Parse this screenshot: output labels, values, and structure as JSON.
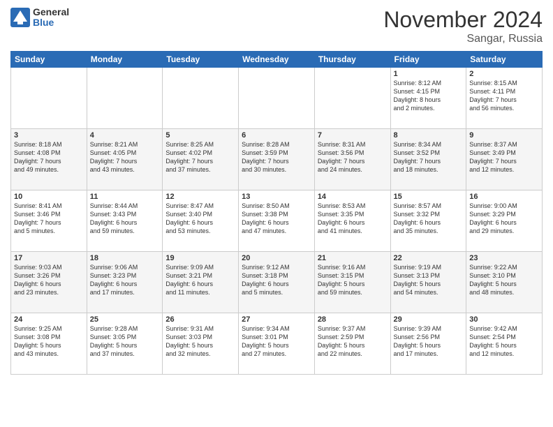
{
  "header": {
    "logo_general": "General",
    "logo_blue": "Blue",
    "month_title": "November 2024",
    "location": "Sangar, Russia"
  },
  "weekdays": [
    "Sunday",
    "Monday",
    "Tuesday",
    "Wednesday",
    "Thursday",
    "Friday",
    "Saturday"
  ],
  "weeks": [
    [
      {
        "day": "",
        "info": ""
      },
      {
        "day": "",
        "info": ""
      },
      {
        "day": "",
        "info": ""
      },
      {
        "day": "",
        "info": ""
      },
      {
        "day": "",
        "info": ""
      },
      {
        "day": "1",
        "info": "Sunrise: 8:12 AM\nSunset: 4:15 PM\nDaylight: 8 hours\nand 2 minutes."
      },
      {
        "day": "2",
        "info": "Sunrise: 8:15 AM\nSunset: 4:11 PM\nDaylight: 7 hours\nand 56 minutes."
      }
    ],
    [
      {
        "day": "3",
        "info": "Sunrise: 8:18 AM\nSunset: 4:08 PM\nDaylight: 7 hours\nand 49 minutes."
      },
      {
        "day": "4",
        "info": "Sunrise: 8:21 AM\nSunset: 4:05 PM\nDaylight: 7 hours\nand 43 minutes."
      },
      {
        "day": "5",
        "info": "Sunrise: 8:25 AM\nSunset: 4:02 PM\nDaylight: 7 hours\nand 37 minutes."
      },
      {
        "day": "6",
        "info": "Sunrise: 8:28 AM\nSunset: 3:59 PM\nDaylight: 7 hours\nand 30 minutes."
      },
      {
        "day": "7",
        "info": "Sunrise: 8:31 AM\nSunset: 3:56 PM\nDaylight: 7 hours\nand 24 minutes."
      },
      {
        "day": "8",
        "info": "Sunrise: 8:34 AM\nSunset: 3:52 PM\nDaylight: 7 hours\nand 18 minutes."
      },
      {
        "day": "9",
        "info": "Sunrise: 8:37 AM\nSunset: 3:49 PM\nDaylight: 7 hours\nand 12 minutes."
      }
    ],
    [
      {
        "day": "10",
        "info": "Sunrise: 8:41 AM\nSunset: 3:46 PM\nDaylight: 7 hours\nand 5 minutes."
      },
      {
        "day": "11",
        "info": "Sunrise: 8:44 AM\nSunset: 3:43 PM\nDaylight: 6 hours\nand 59 minutes."
      },
      {
        "day": "12",
        "info": "Sunrise: 8:47 AM\nSunset: 3:40 PM\nDaylight: 6 hours\nand 53 minutes."
      },
      {
        "day": "13",
        "info": "Sunrise: 8:50 AM\nSunset: 3:38 PM\nDaylight: 6 hours\nand 47 minutes."
      },
      {
        "day": "14",
        "info": "Sunrise: 8:53 AM\nSunset: 3:35 PM\nDaylight: 6 hours\nand 41 minutes."
      },
      {
        "day": "15",
        "info": "Sunrise: 8:57 AM\nSunset: 3:32 PM\nDaylight: 6 hours\nand 35 minutes."
      },
      {
        "day": "16",
        "info": "Sunrise: 9:00 AM\nSunset: 3:29 PM\nDaylight: 6 hours\nand 29 minutes."
      }
    ],
    [
      {
        "day": "17",
        "info": "Sunrise: 9:03 AM\nSunset: 3:26 PM\nDaylight: 6 hours\nand 23 minutes."
      },
      {
        "day": "18",
        "info": "Sunrise: 9:06 AM\nSunset: 3:23 PM\nDaylight: 6 hours\nand 17 minutes."
      },
      {
        "day": "19",
        "info": "Sunrise: 9:09 AM\nSunset: 3:21 PM\nDaylight: 6 hours\nand 11 minutes."
      },
      {
        "day": "20",
        "info": "Sunrise: 9:12 AM\nSunset: 3:18 PM\nDaylight: 6 hours\nand 5 minutes."
      },
      {
        "day": "21",
        "info": "Sunrise: 9:16 AM\nSunset: 3:15 PM\nDaylight: 5 hours\nand 59 minutes."
      },
      {
        "day": "22",
        "info": "Sunrise: 9:19 AM\nSunset: 3:13 PM\nDaylight: 5 hours\nand 54 minutes."
      },
      {
        "day": "23",
        "info": "Sunrise: 9:22 AM\nSunset: 3:10 PM\nDaylight: 5 hours\nand 48 minutes."
      }
    ],
    [
      {
        "day": "24",
        "info": "Sunrise: 9:25 AM\nSunset: 3:08 PM\nDaylight: 5 hours\nand 43 minutes."
      },
      {
        "day": "25",
        "info": "Sunrise: 9:28 AM\nSunset: 3:05 PM\nDaylight: 5 hours\nand 37 minutes."
      },
      {
        "day": "26",
        "info": "Sunrise: 9:31 AM\nSunset: 3:03 PM\nDaylight: 5 hours\nand 32 minutes."
      },
      {
        "day": "27",
        "info": "Sunrise: 9:34 AM\nSunset: 3:01 PM\nDaylight: 5 hours\nand 27 minutes."
      },
      {
        "day": "28",
        "info": "Sunrise: 9:37 AM\nSunset: 2:59 PM\nDaylight: 5 hours\nand 22 minutes."
      },
      {
        "day": "29",
        "info": "Sunrise: 9:39 AM\nSunset: 2:56 PM\nDaylight: 5 hours\nand 17 minutes."
      },
      {
        "day": "30",
        "info": "Sunrise: 9:42 AM\nSunset: 2:54 PM\nDaylight: 5 hours\nand 12 minutes."
      }
    ]
  ]
}
